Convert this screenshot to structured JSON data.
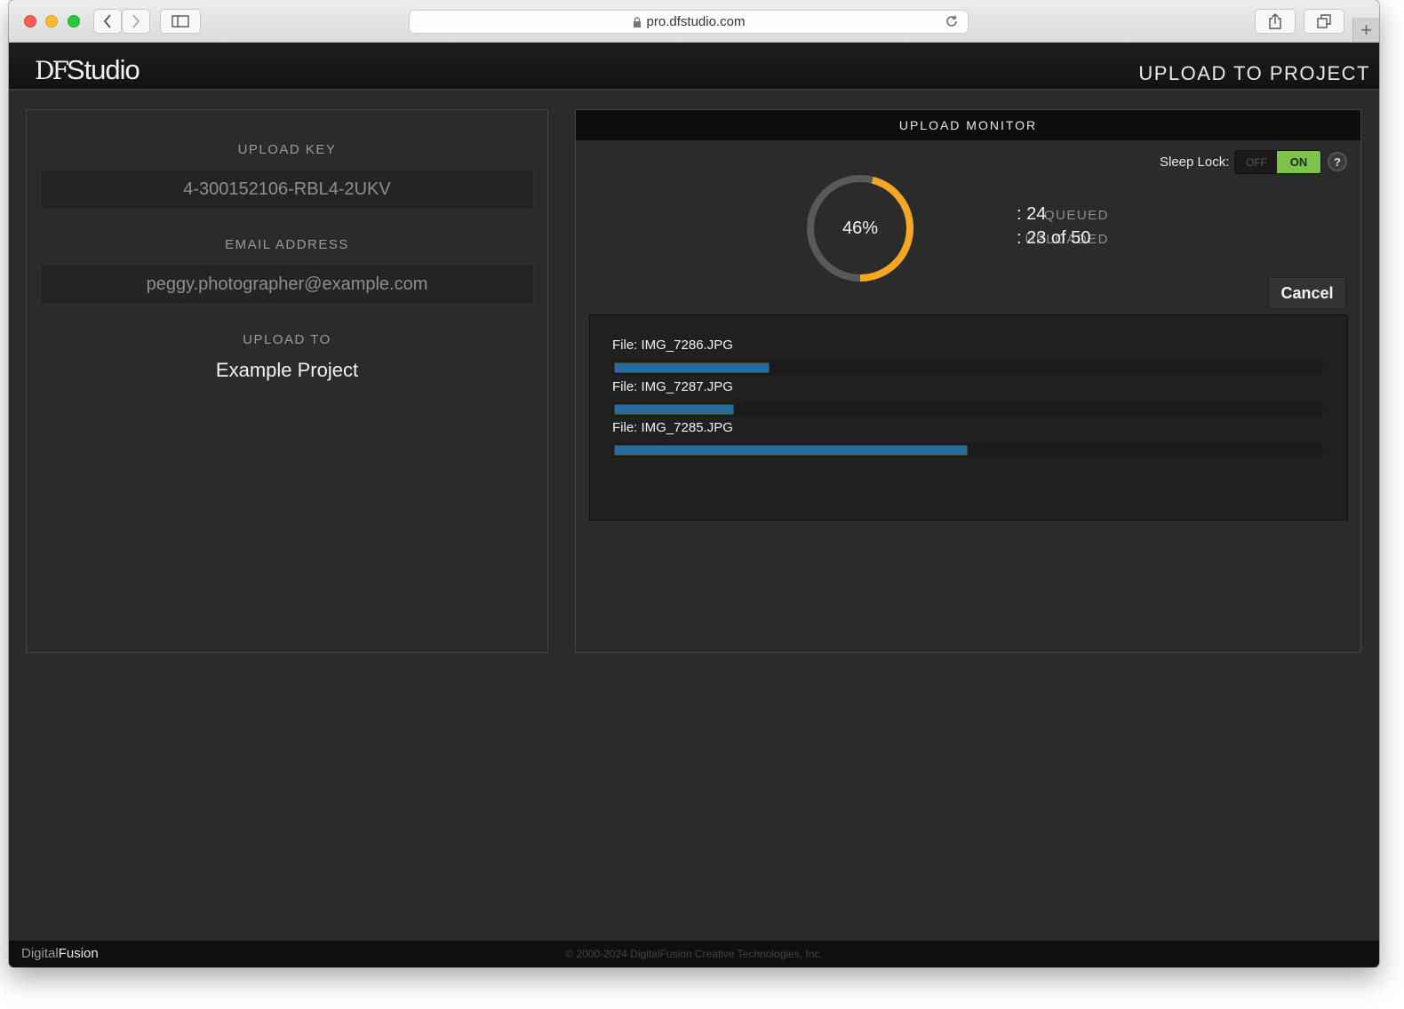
{
  "browser": {
    "url": "pro.dfstudio.com"
  },
  "app": {
    "logo_df": "DF",
    "logo_studio": "Studio",
    "page_title": "UPLOAD TO PROJECT"
  },
  "left": {
    "upload_key_label": "UPLOAD KEY",
    "upload_key_value": "4-300152106-RBL4-2UKV",
    "email_label": "EMAIL ADDRESS",
    "email_value": "peggy.photographer@example.com",
    "upload_to_label": "UPLOAD TO",
    "upload_to_value": "Example Project"
  },
  "monitor": {
    "title": "UPLOAD MONITOR",
    "sleep_lock_label": "Sleep Lock:",
    "sleep_lock_off": "OFF",
    "sleep_lock_on": "ON",
    "sleep_lock_state": "ON",
    "help_label": "?",
    "progress_percent": 46,
    "progress_text": "46%",
    "queued_label": "QUEUED",
    "queued_value": ": 24",
    "uploaded_label": "UPLOADED",
    "uploaded_value": ": 23 of 50",
    "cancel_label": "Cancel",
    "files": [
      {
        "name": "File: IMG_7286.JPG",
        "progress": 0.22
      },
      {
        "name": "File: IMG_7287.JPG",
        "progress": 0.17
      },
      {
        "name": "File: IMG_7285.JPG",
        "progress": 0.5
      }
    ]
  },
  "footer": {
    "brand_digital": "Digital",
    "brand_fusion": "Fusion",
    "copyright": "© 2000-2024 DigitalFusion Creative Technologies, Inc."
  },
  "colors": {
    "progress_ring": "#f5a623",
    "ring_track": "#5a5a5a",
    "toggle_on": "#7dc24f",
    "file_bar": "#2a6b9d"
  }
}
